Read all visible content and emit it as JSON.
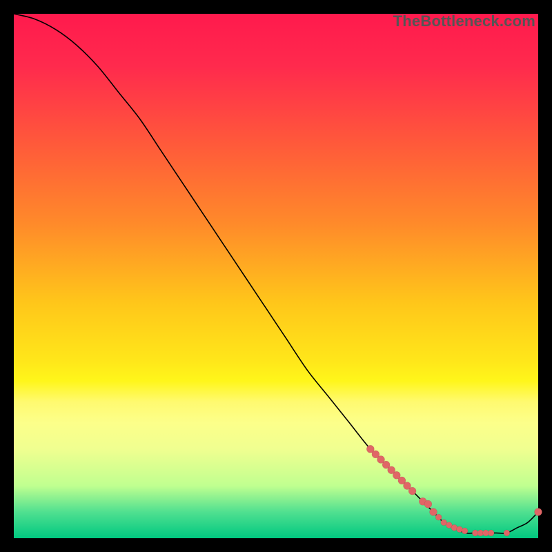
{
  "watermark": "TheBottleneck.com",
  "colors": {
    "gradient_top": "#ff1a4d",
    "gradient_bottom": "#00c880",
    "line": "#000000",
    "dot": "#e06666",
    "frame": "#000000"
  },
  "chart_data": {
    "type": "line",
    "title": "",
    "xlabel": "",
    "ylabel": "",
    "xlim": [
      0,
      100
    ],
    "ylim": [
      0,
      100
    ],
    "grid": false,
    "legend": false,
    "annotations": [
      "TheBottleneck.com"
    ],
    "series": [
      {
        "name": "curve",
        "x": [
          0,
          4,
          8,
          12,
          16,
          20,
          24,
          28,
          32,
          36,
          40,
          44,
          48,
          52,
          56,
          60,
          64,
          68,
          72,
          74,
          76,
          78,
          80,
          82,
          84,
          86,
          88,
          90,
          92,
          94,
          96,
          98,
          100
        ],
        "values": [
          100,
          99,
          97,
          94,
          90,
          85,
          80,
          74,
          68,
          62,
          56,
          50,
          44,
          38,
          32,
          27,
          22,
          17,
          13,
          11,
          9,
          7,
          5,
          3,
          2,
          1,
          1,
          1,
          1,
          1,
          2,
          3,
          5
        ]
      }
    ],
    "markers": {
      "name": "highlighted-points",
      "x": [
        68,
        69,
        70,
        71,
        72,
        73,
        74,
        75,
        76,
        78,
        79,
        80,
        81,
        82,
        83,
        84,
        85,
        86,
        88,
        89,
        90,
        91,
        94,
        100
      ],
      "values": [
        17,
        16,
        15,
        14,
        13,
        12,
        11,
        10,
        9,
        7,
        6.5,
        5,
        4,
        3,
        2.5,
        2,
        1.7,
        1.4,
        1,
        1,
        1,
        1,
        1,
        5
      ]
    }
  }
}
